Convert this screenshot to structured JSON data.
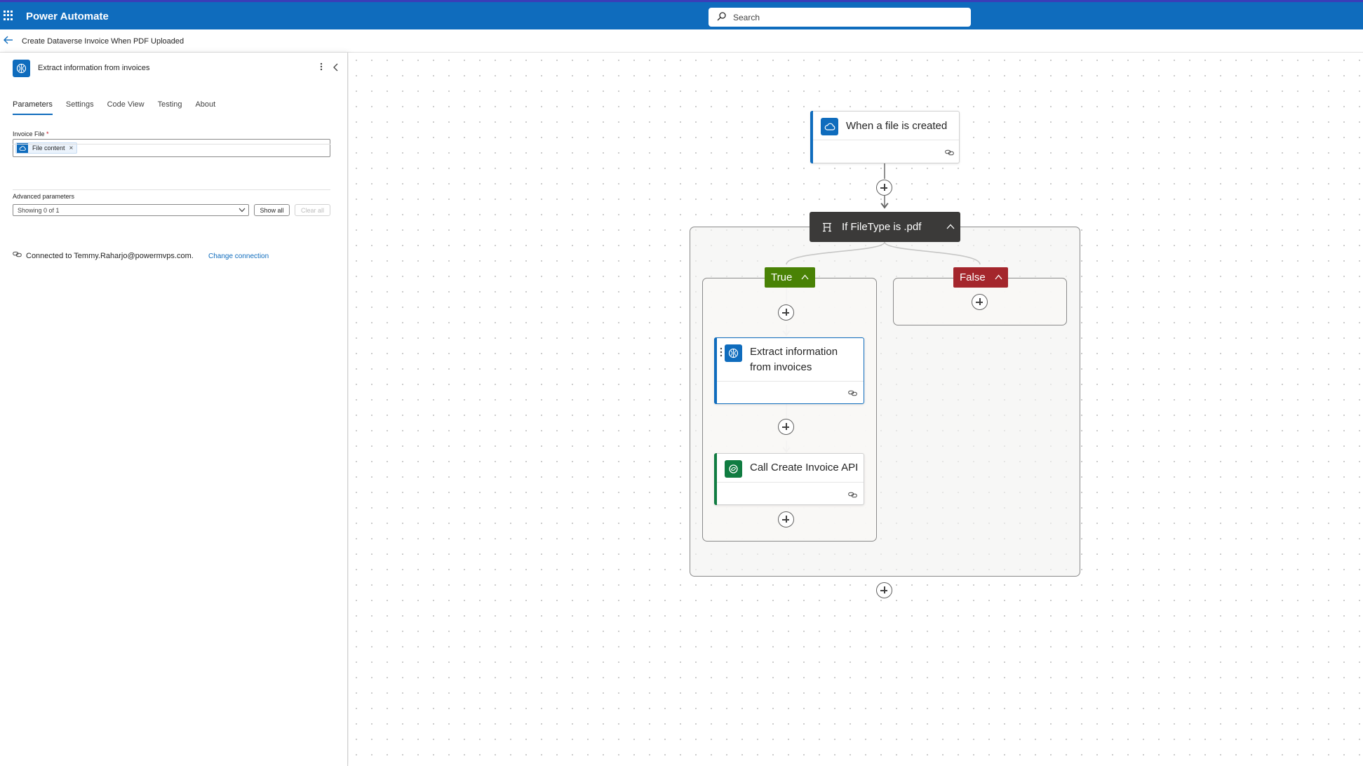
{
  "app": {
    "title": "Power Automate",
    "brand_color": "#0f6cbd"
  },
  "search": {
    "placeholder": "Search"
  },
  "breadcrumb": {
    "flow_name": "Create Dataverse Invoice When PDF Uploaded"
  },
  "panel": {
    "title": "Extract information from invoices",
    "tabs": [
      {
        "label": "Parameters",
        "active": true
      },
      {
        "label": "Settings"
      },
      {
        "label": "Code View"
      },
      {
        "label": "Testing"
      },
      {
        "label": "About"
      }
    ],
    "invoice_field": {
      "label": "Invoice File",
      "required_mark": "*",
      "token": "File content",
      "token_remove": "×"
    },
    "advanced": {
      "label": "Advanced parameters",
      "select_value": "Showing 0 of 1",
      "show_all": "Show all",
      "clear_all": "Clear all"
    },
    "connection": {
      "text": "Connected to Temmy.Raharjo@powermvps.com.",
      "change_link": "Change connection"
    }
  },
  "flow": {
    "trigger": {
      "title": "When a file is created",
      "icon": "onedrive-cloud-icon"
    },
    "condition": {
      "title": "If FileType is .pdf",
      "icon": "condition-icon"
    },
    "true_branch": {
      "label": "True",
      "color": "#498205"
    },
    "false_branch": {
      "label": "False",
      "color": "#a4262c"
    },
    "action_extract": {
      "title_line1": "Extract information",
      "title_line2": "from invoices",
      "icon": "ai-builder-icon"
    },
    "action_api": {
      "title": "Call Create Invoice API",
      "icon": "dataverse-icon",
      "color": "#107c41"
    }
  }
}
